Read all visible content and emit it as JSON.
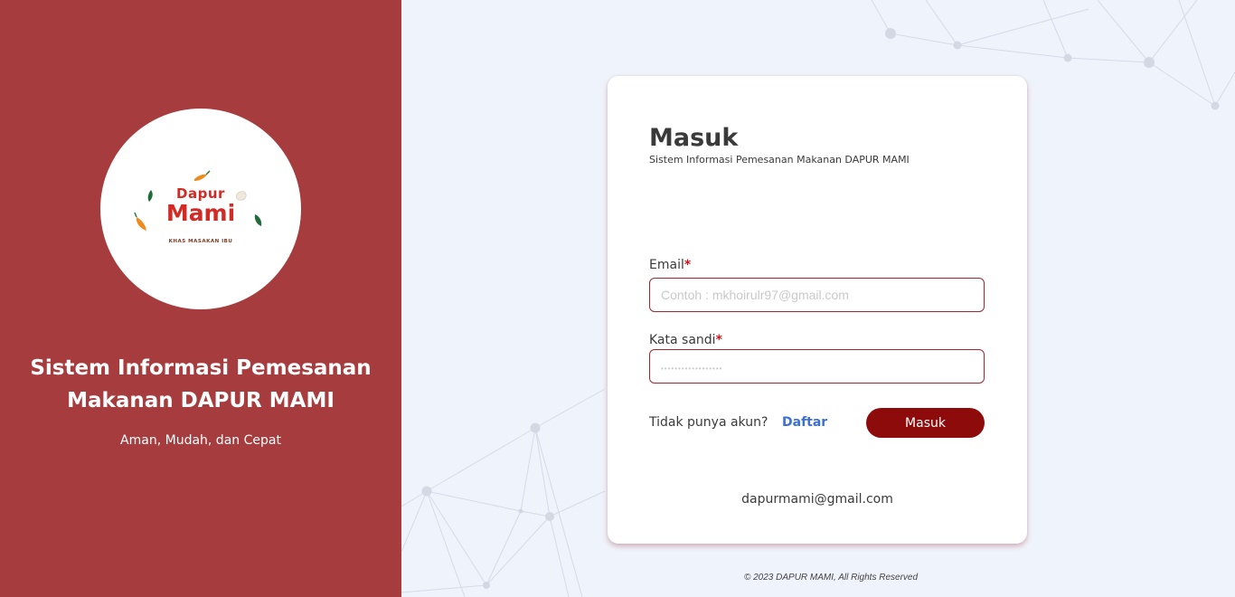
{
  "brand": {
    "logo_word_1": "Dapur",
    "logo_word_2": "Mami",
    "logo_tagline": "KHAS MASAKAN IBU",
    "title": "Sistem Informasi Pemesanan Makanan DAPUR MAMI",
    "subtitle": "Aman, Mudah, dan Cepat"
  },
  "login": {
    "heading": "Masuk",
    "subheading": "Sistem Informasi Pemesanan Makanan DAPUR MAMI",
    "email_label": "Email",
    "email_placeholder": "Contoh : mkhoirulr97@gmail.com",
    "password_label": "Kata sandi",
    "password_placeholder": "••••••••••••••••••",
    "required_mark": "*",
    "no_account_text": "Tidak punya akun?",
    "register_link": "Daftar",
    "submit_label": "Masuk",
    "contact_email": "dapurmami@gmail.com"
  },
  "footer": {
    "copyright": "© 2023 DAPUR MAMI, All Rights Reserved"
  },
  "colors": {
    "left_panel": "#a63c3e",
    "primary_button": "#8e0b0b",
    "link": "#3b6fd4",
    "required": "#d0141b",
    "background": "#eff3fb"
  },
  "icons": [
    "chili-icon",
    "leaf-icon",
    "garlic-icon"
  ]
}
